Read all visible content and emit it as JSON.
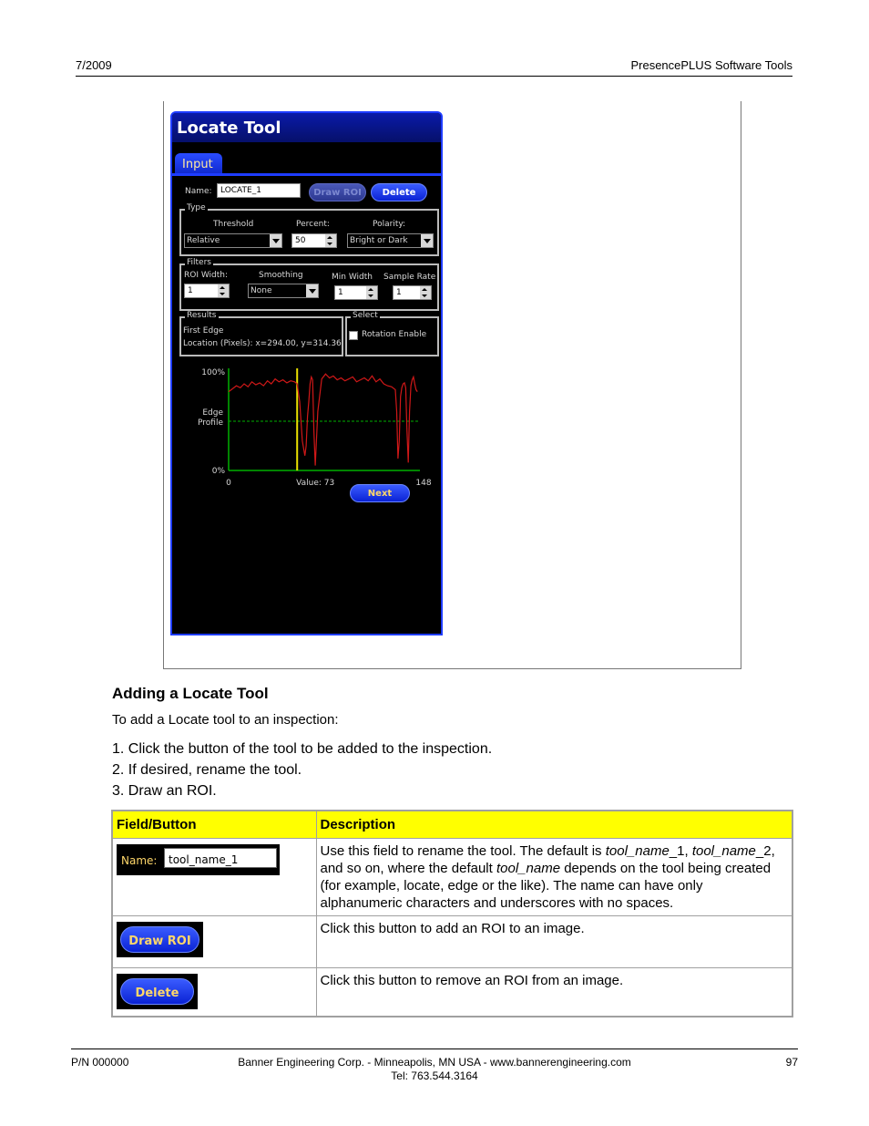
{
  "header": {
    "date": "7/2009",
    "doc_title": "PresencePLUS Software Tools"
  },
  "panel": {
    "title": "Locate Tool",
    "tab": "Input",
    "name_label": "Name:",
    "name_value": "LOCATE_1",
    "draw_roi": "Draw ROI",
    "delete": "Delete",
    "type_group": "Type",
    "threshold_label": "Threshold",
    "threshold_value": "Relative",
    "percent_label": "Percent:",
    "percent_value": "50",
    "polarity_label": "Polarity:",
    "polarity_value": "Bright or Dark",
    "filters_group": "Filters",
    "roi_width_label": "ROI Width:",
    "roi_width_value": "1",
    "smoothing_label": "Smoothing",
    "smoothing_value": "None",
    "min_width_label": "Min Width",
    "min_width_value": "1",
    "sample_rate_label": "Sample Rate",
    "sample_rate_value": "1",
    "results_group": "Results",
    "results_line1": "First Edge",
    "results_line2": "Location (Pixels):  x=294.00, y=314.36",
    "select_group": "Select",
    "rotation_label": "Rotation Enable",
    "rotation_checked": false,
    "next": "Next"
  },
  "chart_data": {
    "type": "line",
    "series_color": "#d01818",
    "threshold_color": "#00b000",
    "marker_color": "#e8e000",
    "y_top_label": "100%",
    "y_bottom_label": "0%",
    "y_mid_label_1": "Edge",
    "y_mid_label_2": "Profile",
    "x_min_label": "0",
    "x_max_label": "148",
    "value_label": "Value:  73",
    "xlim": [
      0,
      148
    ],
    "ylim": [
      0,
      100
    ],
    "threshold": 50,
    "marker_x": 53,
    "x": [
      0,
      3,
      6,
      9,
      12,
      15,
      18,
      21,
      24,
      27,
      30,
      33,
      36,
      39,
      42,
      45,
      48,
      51,
      53,
      55,
      57,
      59,
      60,
      61,
      62,
      63,
      64,
      65,
      66,
      67,
      69,
      72,
      75,
      78,
      81,
      84,
      87,
      90,
      93,
      96,
      99,
      102,
      105,
      108,
      111,
      114,
      117,
      120,
      123,
      126,
      129,
      130,
      131,
      132,
      133,
      134,
      135,
      136,
      137,
      138,
      139,
      140,
      141,
      142,
      143,
      144,
      145,
      146
    ],
    "y": [
      80,
      83,
      86,
      84,
      88,
      85,
      90,
      87,
      89,
      86,
      91,
      88,
      93,
      90,
      92,
      89,
      91,
      90,
      88,
      70,
      30,
      15,
      25,
      55,
      70,
      88,
      95,
      92,
      40,
      5,
      60,
      93,
      98,
      94,
      96,
      92,
      94,
      91,
      93,
      95,
      90,
      92,
      94,
      91,
      96,
      90,
      93,
      88,
      86,
      85,
      82,
      60,
      12,
      30,
      75,
      84,
      88,
      89,
      84,
      40,
      8,
      60,
      86,
      92,
      95,
      88,
      82,
      80
    ]
  },
  "section": {
    "title": "Adding a Locate Tool",
    "intro": "To add a Locate tool to an inspection:",
    "steps": [
      "1.  Click the button of the tool to be added to the inspection.",
      "2.  If desired, rename the tool.",
      "3.  Draw an ROI."
    ]
  },
  "table": {
    "col1": "Field/Button",
    "col2": "Description",
    "row1_example_label": "Name:",
    "row1_example_value": "tool_name_1",
    "row2_button": "Draw ROI",
    "row3_button": "Delete",
    "row1_desc": {
      "a": "Use this field to rename the tool. The default is ",
      "i1": "tool_name",
      "b": "_1, ",
      "i2": "tool_name",
      "c": "_2, and so on, where the default ",
      "i3": "tool_name",
      "d": " depends on the tool being created (for example, locate, edge or the like). The name can have only alphanumeric characters and underscores with no spaces."
    },
    "row2_desc": "Click this button to add an ROI to an image.",
    "row3_desc": "Click this button to remove an ROI from an image."
  },
  "footer": {
    "part_number": "P/N 000000",
    "company": "Banner Engineering Corp. - Minneapolis, MN USA - www.bannerengineering.com",
    "phone": "Tel: 763.544.3164",
    "page": "97"
  }
}
